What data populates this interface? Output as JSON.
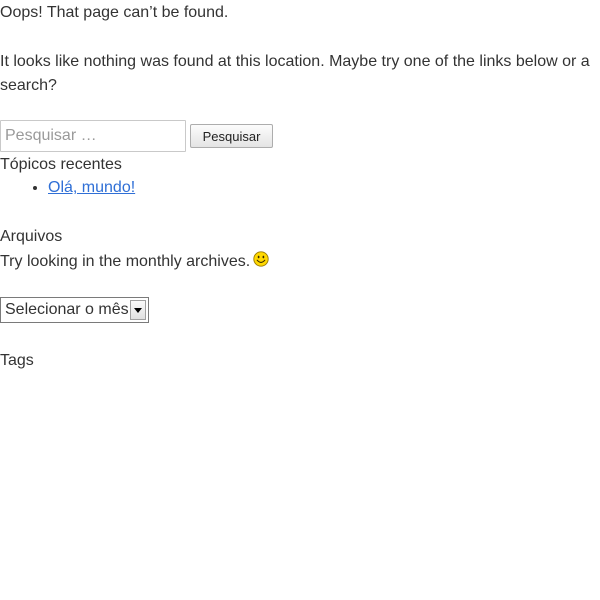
{
  "page": {
    "title": "Oops! That page can’t be found.",
    "notice": "It looks like nothing was found at this location. Maybe try one of the links below or a search?"
  },
  "search": {
    "placeholder": "Pesquisar …",
    "value": "",
    "button_label": "Pesquisar"
  },
  "recent_posts": {
    "title": "Tópicos recentes",
    "items": [
      {
        "label": "Olá, mundo!"
      }
    ]
  },
  "archives": {
    "title": "Arquivos",
    "text": "Try looking in the monthly archives.",
    "smiley_icon": "smiley-face-icon",
    "select": {
      "selected": "Selecionar o mês",
      "arrow_icon": "chevron-down-icon"
    }
  },
  "tags": {
    "title": "Tags"
  },
  "colors": {
    "text": "#333333",
    "link": "#2f6fd6",
    "smiley": "#ffd800"
  }
}
